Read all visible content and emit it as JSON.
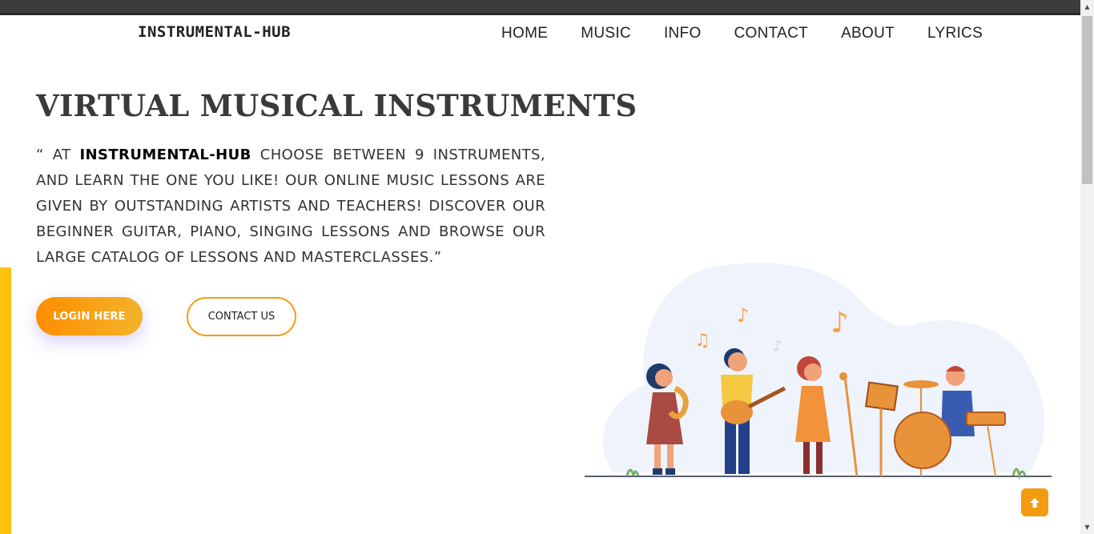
{
  "header": {
    "logo": "INSTRUMENTAL-HUB",
    "nav": [
      "HOME",
      "MUSIC",
      "INFO",
      "CONTACT",
      "ABOUT",
      "LYRICS"
    ]
  },
  "hero": {
    "title": "VIRTUAL MUSICAL INSTRUMENTS",
    "text_open": "“ AT ",
    "text_brand": "INSTRUMENTAL-HUB",
    "text_body": " CHOOSE BETWEEN 9 INSTRUMENTS, AND LEARN THE ONE YOU LIKE! OUR ONLINE MUSIC LESSONS ARE GIVEN BY OUTSTANDING ARTISTS AND TEACHERS! DISCOVER OUR BEGINNER GUITAR, PIANO, SINGING LESSONS AND BROWSE OUR LARGE CATALOG OF LESSONS AND MASTERCLASSES.”",
    "login_label": "LOGIN HERE",
    "contact_label": "CONTACT US"
  },
  "icons": {
    "back_to_top": "arrow-up-icon",
    "scroll_up": "scroll-up-arrow-icon",
    "scroll_down": "scroll-down-arrow-icon"
  },
  "colors": {
    "accent": "#f39c12",
    "side_accent": "#ffc20e",
    "topbar": "#3c3c3c"
  }
}
